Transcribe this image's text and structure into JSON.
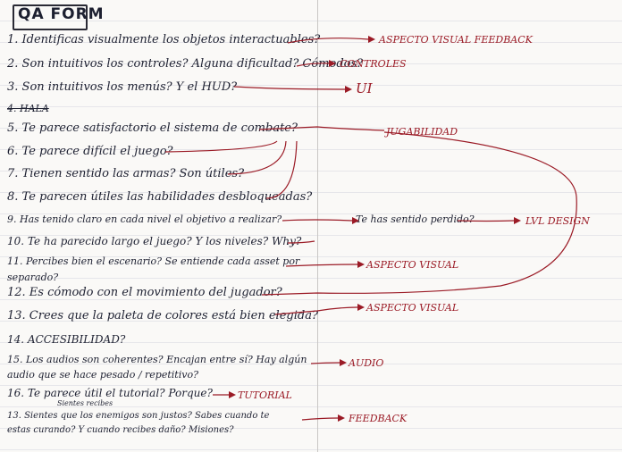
{
  "title": "QA FORM",
  "questions": [
    "1. Identificas visualmente los objetos interactuables?",
    "2. Son intuitivos los controles? Alguna dificultad? Cómodos?",
    "3. Son intuitivos los menús? Y el HUD?",
    "4. HALA",
    "5. Te parece satisfactorio el sistema de combate?",
    "6. Te parece difícil el juego?",
    "7. Tienen sentido las armas? Son útiles?",
    "8. Te parecen útiles las habilidades desbloqueadas?",
    "9. Has tenido claro en cada nivel el objetivo a realizar?",
    "10. Te ha parecido largo el juego? Y los niveles? Why?",
    "11. Percibes bien el escenario? Se entiende cada asset por",
    "separado?",
    "12. Es cómodo con el movimiento del jugador?",
    "13. Crees que la paleta de colores está bien elegida?",
    "14. ACCESIBILIDAD?",
    "15. Los audios son coherentes? Encajan entre sí? Hay algún",
    "audio que se hace pesado / repetitivo?",
    "16. Te parece útil el tutorial? Porque?",
    "13. Sientes que los enemigos son justos? Sabes cuando te",
    "estas curando? Y cuando recibes daño? Misiones?"
  ],
  "q9_extra": "Te has sentido perdido?",
  "q18_above": "Sientes   recibes",
  "labels": {
    "aspecto_visual_feedback": "ASPECTO VISUAL FEEDBACK",
    "controles": "CONTROLES",
    "ui": "UI",
    "jugabilidad": "JUGABILIDAD",
    "lvl_design": "LVL DESIGN",
    "aspecto_visual_1": "ASPECTO VISUAL",
    "aspecto_visual_2": "ASPECTO VISUAL",
    "audio": "AUDIO",
    "tutorial": "TUTORIAL",
    "feedback": "FEEDBACK"
  },
  "colors": {
    "ink": "#1e2132",
    "red_ink": "#9b1b26"
  }
}
